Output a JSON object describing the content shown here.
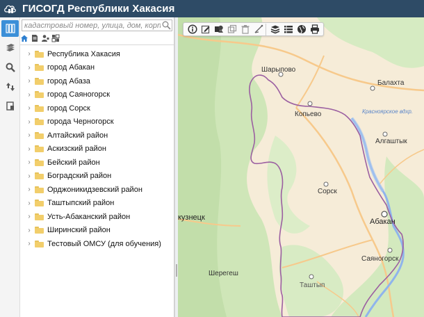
{
  "header": {
    "title": "ГИСОГД Республики Хакасия",
    "background": "#2e4b66",
    "logo_icon": "cloud-building-logo"
  },
  "rail": {
    "items": [
      {
        "name": "layers-tree",
        "icon": "tree-grid-icon",
        "active": true
      },
      {
        "name": "basemaps",
        "icon": "layers-stack-icon",
        "active": false
      },
      {
        "name": "search",
        "icon": "magnifier-icon",
        "active": false
      },
      {
        "name": "routes",
        "icon": "arrows-icon",
        "active": false
      },
      {
        "name": "bookmarks",
        "icon": "bookmark-icon",
        "active": false
      }
    ],
    "active_color": "#3b8fd8"
  },
  "search": {
    "placeholder": "кадастровый номер, улица, дом, корпус",
    "value": "",
    "icon": "search-icon"
  },
  "tree_modes": [
    "home-icon",
    "document-icon",
    "user-icon",
    "grid-icon"
  ],
  "tree": {
    "items": [
      {
        "label": "Республика Хакасия"
      },
      {
        "label": "город Абакан"
      },
      {
        "label": "город Абаза"
      },
      {
        "label": "город Саяногорск"
      },
      {
        "label": "город Сорск"
      },
      {
        "label": "города Черногорск"
      },
      {
        "label": "Алтайский район"
      },
      {
        "label": "Аскизский район"
      },
      {
        "label": "Бейский район"
      },
      {
        "label": "Боградский район"
      },
      {
        "label": "Орджоникидзевский район"
      },
      {
        "label": "Таштыпский район"
      },
      {
        "label": "Усть-Абаканский район"
      },
      {
        "label": "Ширинский район"
      },
      {
        "label": "Тестовый ОМСУ (для обучения)"
      }
    ]
  },
  "map_toolbar": {
    "tools": [
      "info-icon",
      "edit-icon",
      "objects-icon",
      "copy-icon",
      "delete-icon",
      "measure-icon",
      "layers-icon",
      "list-icon",
      "globe-icon",
      "print-icon"
    ]
  },
  "map": {
    "labels": {
      "sharypovo": "Шарыпово",
      "kopyevo": "Копьево",
      "balakhta": "Балахта",
      "reservoir": "Красноярское вдхр.",
      "algashtyk": "Алгаштык",
      "sorsk": "Сорск",
      "abakan": "Абакан",
      "kuznetsk": "кузнецк",
      "sayanogorsk": "Саяногорск",
      "sheregesh": "Шерегеш",
      "tashtyp": "Таштып"
    },
    "colors": {
      "land": "#f6ecd8",
      "forest": "#cfe6b8",
      "river": "#8fb4ec",
      "border": "#9b5fa1",
      "road": "#f7c98b"
    }
  }
}
